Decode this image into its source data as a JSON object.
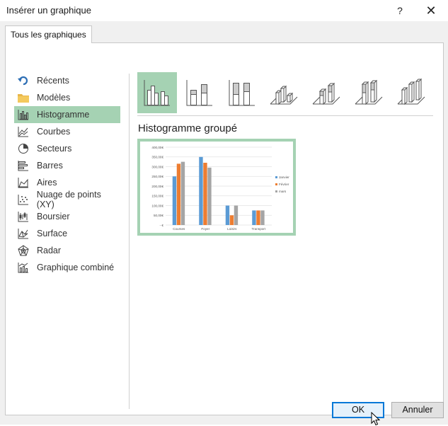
{
  "window": {
    "title": "Insérer un graphique",
    "help_label": "?",
    "close_label": "✕"
  },
  "tabs": [
    {
      "label": "Tous les graphiques"
    }
  ],
  "categories": [
    {
      "label": "Récents",
      "icon": "undo-arrow-icon"
    },
    {
      "label": "Modèles",
      "icon": "folder-icon"
    },
    {
      "label": "Histogramme",
      "icon": "column-chart-icon",
      "selected": true
    },
    {
      "label": "Courbes",
      "icon": "line-chart-icon"
    },
    {
      "label": "Secteurs",
      "icon": "pie-chart-icon"
    },
    {
      "label": "Barres",
      "icon": "bar-chart-icon"
    },
    {
      "label": "Aires",
      "icon": "area-chart-icon"
    },
    {
      "label": "Nuage de points (XY)",
      "icon": "scatter-chart-icon"
    },
    {
      "label": "Boursier",
      "icon": "stock-chart-icon"
    },
    {
      "label": "Surface",
      "icon": "surface-chart-icon"
    },
    {
      "label": "Radar",
      "icon": "radar-chart-icon"
    },
    {
      "label": "Graphique combiné",
      "icon": "combo-chart-icon"
    }
  ],
  "subtypes": [
    {
      "icon": "clustered-column-icon",
      "selected": true
    },
    {
      "icon": "stacked-column-icon"
    },
    {
      "icon": "stacked-100-column-icon"
    },
    {
      "icon": "3d-clustered-column-icon"
    },
    {
      "icon": "3d-stacked-column-icon"
    },
    {
      "icon": "3d-stacked-100-column-icon"
    },
    {
      "icon": "3d-column-icon"
    }
  ],
  "selected_subtype_name": "Histogramme groupé",
  "colors": {
    "selection": "#a5d2b3",
    "series_1": "#5b9bd5",
    "series_2": "#ed7d31",
    "series_3": "#a5a5a5"
  },
  "chart_data": {
    "type": "bar",
    "categories": [
      "Courses",
      "Foyer",
      "Loisirs",
      "Transport"
    ],
    "series": [
      {
        "name": "Janvier",
        "values": [
          250,
          350,
          100,
          75
        ]
      },
      {
        "name": "Février",
        "values": [
          315,
          320,
          50,
          75
        ]
      },
      {
        "name": "mars",
        "values": [
          325,
          295,
          100,
          75
        ]
      }
    ],
    "yticks": [
      "- €",
      "50,00€",
      "100,00€",
      "150,00€",
      "200,00€",
      "250,00€",
      "300,00€",
      "350,00€",
      "400,00€"
    ],
    "ylim": [
      0,
      400
    ],
    "grid": true,
    "legend": "right"
  },
  "buttons": {
    "ok": "OK",
    "cancel": "Annuler"
  }
}
